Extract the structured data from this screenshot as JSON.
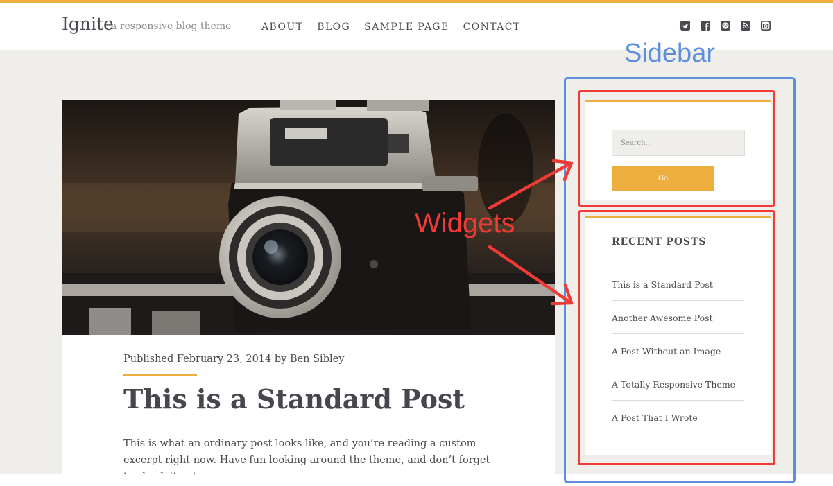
{
  "site": {
    "logo": "Ignite",
    "tagline": "a responsive blog theme"
  },
  "nav": {
    "items": [
      {
        "label": "ABOUT"
      },
      {
        "label": "BLOG"
      },
      {
        "label": "SAMPLE PAGE"
      },
      {
        "label": "CONTACT"
      }
    ]
  },
  "social": {
    "icons": [
      "twitter-icon",
      "facebook-icon",
      "pinterest-icon",
      "rss-icon",
      "instagram-icon"
    ]
  },
  "post": {
    "meta": "Published February 23, 2014 by Ben Sibley",
    "title": "This is a Standard Post",
    "excerpt": "This is what an ordinary post looks like, and you’re reading a custom excerpt right now. Have fun looking around the theme, and don’t forget to check it out"
  },
  "sidebar": {
    "search": {
      "placeholder": "Search...",
      "button_label": "Go"
    },
    "recent_posts": {
      "title": "RECENT POSTS",
      "items": [
        {
          "label": "This is a Standard Post"
        },
        {
          "label": "Another Awesome Post"
        },
        {
          "label": "A Post Without an Image"
        },
        {
          "label": "A Totally Responsive Theme"
        },
        {
          "label": "A Post That I Wrote"
        }
      ]
    }
  },
  "annotations": {
    "sidebar_label": "Sidebar",
    "widgets_label": "Widgets"
  },
  "colors": {
    "accent": "#eeae3d",
    "page_background": "#efeeeb",
    "text": "#4a4b50",
    "annotation_blue": "#5d8fdd",
    "annotation_red": "#ef3a36"
  }
}
